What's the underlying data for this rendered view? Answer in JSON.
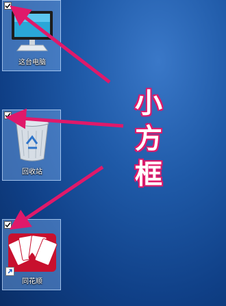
{
  "desktop_icons": [
    {
      "label": "这台电脑",
      "checked": true,
      "icon": "monitor-icon"
    },
    {
      "label": "回收站",
      "checked": true,
      "icon": "recycle-bin-icon"
    },
    {
      "label": "同花顺",
      "checked": true,
      "icon": "playing-cards-icon",
      "shortcut": true
    }
  ],
  "annotation": {
    "chars": [
      "小",
      "方",
      "框"
    ],
    "color": "#e0196a"
  },
  "colors": {
    "arrow": "#e0196a",
    "desktop": "#1f5aa8"
  }
}
